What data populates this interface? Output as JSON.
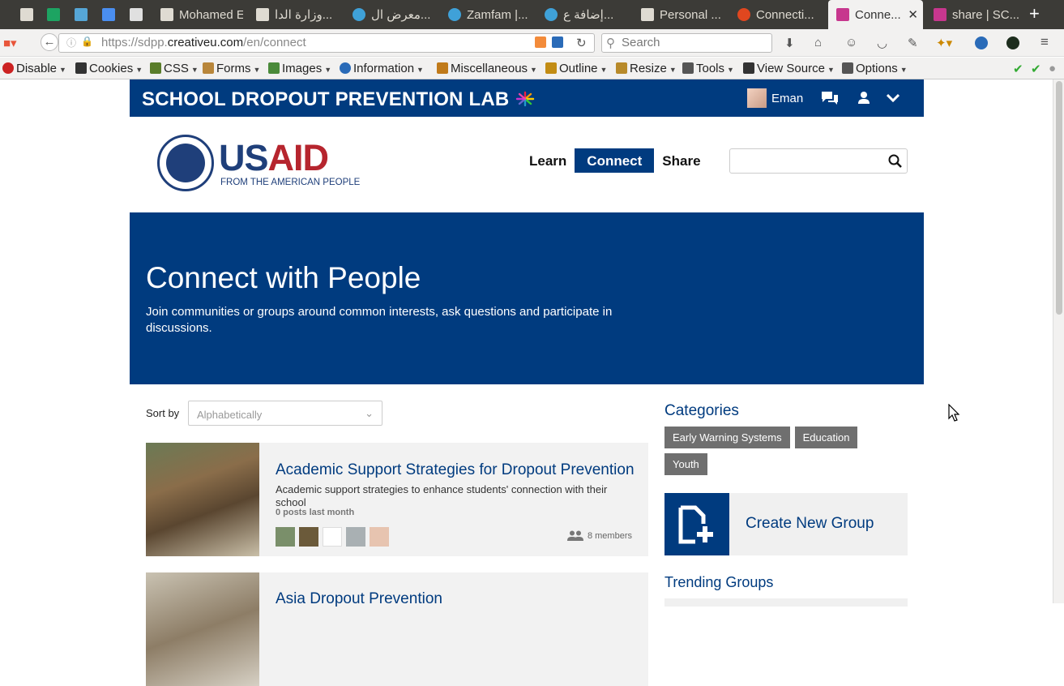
{
  "browser": {
    "tabs": [
      {
        "title": "",
        "icon": "gmail-icon",
        "color": "#dfdbd2",
        "pinned": true
      },
      {
        "title": "",
        "icon": "sheets-icon",
        "color": "#1da462",
        "pinned": true
      },
      {
        "title": "",
        "icon": "asterisk-icon",
        "color": "#56a6d6",
        "pinned": true
      },
      {
        "title": "",
        "icon": "docs-icon",
        "color": "#4a8ef0",
        "pinned": true
      },
      {
        "title": "",
        "icon": "odoo-icon",
        "color": "#e0e0e0",
        "pinned": true
      },
      {
        "title": "Mohamed El...",
        "icon": "gmail-icon",
        "color": "#dfdbd2"
      },
      {
        "title": "وزارة الدا...",
        "icon": "document-icon",
        "color": "#dfdbd2"
      },
      {
        "title": "معرض ال...",
        "icon": "circle-icon",
        "color": "#3fa1d8"
      },
      {
        "title": "Zamfam |...",
        "icon": "circle-icon",
        "color": "#3fa1d8"
      },
      {
        "title": "إضافة ع...",
        "icon": "circle-icon",
        "color": "#3fa1d8"
      },
      {
        "title": "Personal ...",
        "icon": "gmail-icon",
        "color": "#dfdbd2"
      },
      {
        "title": "Connecti...",
        "icon": "loading-icon",
        "color": "#e0471f"
      },
      {
        "title": "Conne...",
        "icon": "sdpp-icon",
        "color": "#c7378e",
        "active": true
      },
      {
        "title": "share | SC...",
        "icon": "sdpp-icon",
        "color": "#c7378e"
      }
    ],
    "url_host": "https://sdpp.",
    "url_domain": "creativeu.com",
    "url_path": "/en/connect",
    "search_placeholder": "Search",
    "dev_toolbar": [
      {
        "label": "Disable",
        "icon": "disable-icon",
        "color": "#cc2222"
      },
      {
        "label": "Cookies",
        "icon": "cookies-icon",
        "color": "#333333"
      },
      {
        "label": "CSS",
        "icon": "css-icon",
        "color": "#5a7d2a"
      },
      {
        "label": "Forms",
        "icon": "forms-icon",
        "color": "#b8863b"
      },
      {
        "label": "Images",
        "icon": "images-icon",
        "color": "#4a8a3a"
      },
      {
        "label": "Information",
        "icon": "information-icon",
        "color": "#2a6bb8"
      },
      {
        "label": "Miscellaneous",
        "icon": "miscellaneous-icon",
        "color": "#c07a1a"
      },
      {
        "label": "Outline",
        "icon": "outline-icon",
        "color": "#c28c14"
      },
      {
        "label": "Resize",
        "icon": "resize-icon",
        "color": "#b88a2a"
      },
      {
        "label": "Tools",
        "icon": "tools-icon",
        "color": "#555555"
      },
      {
        "label": "View Source",
        "icon": "view-source-icon",
        "color": "#333333"
      },
      {
        "label": "Options",
        "icon": "options-icon",
        "color": "#555555"
      }
    ]
  },
  "site": {
    "name": "SCHOOL DROPOUT PREVENTION LAB",
    "user_name": "Eman",
    "logo_main": "USAID",
    "logo_tagline": "FROM THE AMERICAN PEOPLE",
    "nav": [
      "Learn",
      "Connect",
      "Share"
    ],
    "hero_title": "Connect with People",
    "hero_sub": "Join communities or groups around common interests, ask questions and participate in discussions.",
    "sort_label": "Sort by",
    "sort_value": "Alphabetically",
    "groups": [
      {
        "title": "Academic Support Strategies for Dropout Prevention",
        "desc": "Academic support strategies to enhance students' connection with their school",
        "posts": "0 posts last month",
        "members": "8 members"
      },
      {
        "title": "Asia Dropout Prevention",
        "desc": "",
        "posts": "",
        "members": ""
      }
    ],
    "categories_title": "Categories",
    "categories": [
      "Early Warning Systems",
      "Education",
      "Youth"
    ],
    "create_label": "Create New Group",
    "trending_title": "Trending Groups"
  }
}
